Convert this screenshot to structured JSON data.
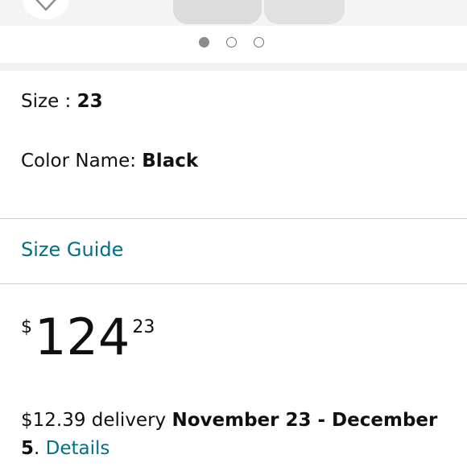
{
  "carousel": {
    "dots": [
      {
        "active": true
      },
      {
        "active": false
      },
      {
        "active": false
      }
    ]
  },
  "variations": {
    "size_label": "Size : ",
    "size_value": "23",
    "color_label": "Color Name: ",
    "color_value": "Black"
  },
  "size_guide": {
    "label": "Size Guide"
  },
  "price": {
    "symbol": "$",
    "whole": "124",
    "fraction": "23"
  },
  "delivery": {
    "fee": "$12.39 delivery ",
    "dates_part1": "November 23 - December",
    "dates_part2": "5",
    "separator": ". ",
    "details_link": "Details"
  },
  "colors": {
    "link": "#007185",
    "text": "#0f1111",
    "divider": "#cccccc",
    "band": "#f0f2f2"
  },
  "icons": {
    "wishlist": "heart-icon"
  }
}
